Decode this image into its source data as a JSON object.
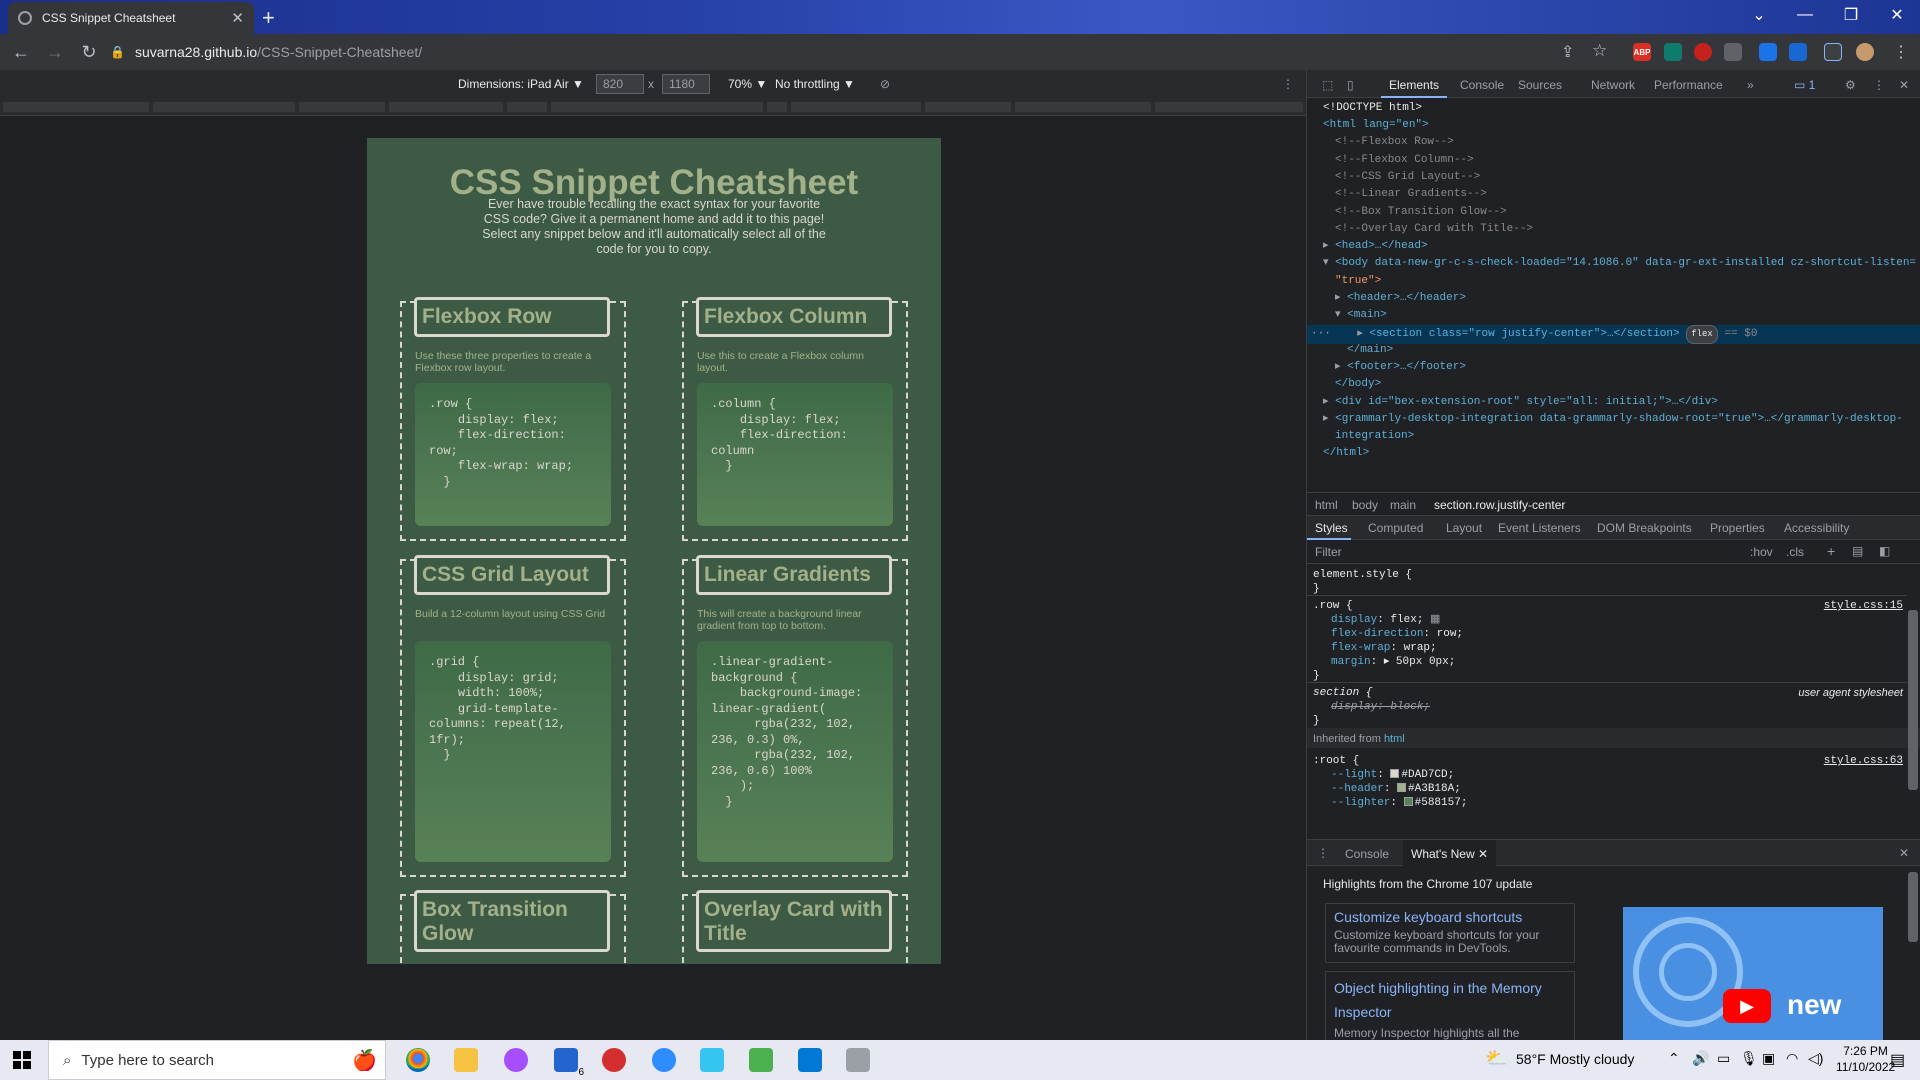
{
  "browser": {
    "tab_title": "CSS Snippet Cheatsheet",
    "url_host": "suvarna28.github.io",
    "url_path": "/CSS-Snippet-Cheatsheet/",
    "ext_abp": "ABP"
  },
  "device_toolbar": {
    "dimensions_label": "Dimensions: iPad Air ▼",
    "width": "820",
    "x": "x",
    "height": "1180",
    "zoom": "70% ▼",
    "throttling": "No throttling ▼"
  },
  "site": {
    "title": "CSS Snippet Cheatsheet",
    "intro": "Ever have trouble recalling the exact syntax for your favorite CSS code? Give it a permanent home and add it to this page! Select any snippet below and it'll automatically select all of the code for you to copy.",
    "cards": [
      {
        "title": "Flexbox Row",
        "desc": "Use these three properties to create a Flexbox row layout.",
        "code": ".row {\n    display: flex;\n    flex-direction: row;\n    flex-wrap: wrap;\n  }"
      },
      {
        "title": "Flexbox Column",
        "desc": "Use this to create a Flexbox column layout.",
        "code": ".column {\n    display: flex;\n    flex-direction:\ncolumn\n  }"
      },
      {
        "title": "CSS Grid Layout",
        "desc": "Build a 12-column layout using CSS Grid",
        "code": ".grid {\n    display: grid;\n    width: 100%;\n    grid-template-\ncolumns: repeat(12,\n1fr);\n  }"
      },
      {
        "title": "Linear Gradients",
        "desc": "This will create a background linear gradient from top to bottom.",
        "code": ".linear-gradient-\nbackground {\n    background-image:\nlinear-gradient(\n      rgba(232, 102,\n236, 0.3) 0%,\n      rgba(232, 102,\n236, 0.6) 100%\n    );\n  }"
      },
      {
        "title": "Box Transition Glow",
        "desc": "",
        "code": ""
      },
      {
        "title": "Overlay Card with Title",
        "desc": "",
        "code": ""
      }
    ]
  },
  "devtools": {
    "tabs": [
      "Elements",
      "Console",
      "Sources",
      "Network",
      "Performance"
    ],
    "more": "»",
    "issues": "1",
    "dom": {
      "doctype": "<!DOCTYPE html>",
      "html_open": "<html lang=\"en\">",
      "comments": [
        "<!--Flexbox Row-->",
        "<!--Flexbox Column-->",
        "<!--CSS Grid Layout-->",
        "<!--Linear Gradients-->",
        "<!--Box Transition Glow-->",
        "<!--Overlay Card with Title-->"
      ],
      "head": "<head>…</head>",
      "body_open": "<body data-new-gr-c-s-check-loaded=\"14.1086.0\" data-gr-ext-installed cz-shortcut-listen=",
      "body_open_cont": "\"true\">",
      "header": "<header>…</header>",
      "main_open": "<main>",
      "section": "<section class=\"row justify-center\">…</section>",
      "flex_badge": "flex",
      "eq0": "== $0",
      "main_close": "</main>",
      "footer": "<footer>…</footer>",
      "body_close": "</body>",
      "bex": "<div id=\"bex-extension-root\" style=\"all: initial;\">…</div>",
      "grammarly": "<grammarly-desktop-integration data-grammarly-shadow-root=\"true\">…</grammarly-desktop-",
      "grammarly_cont": "integration>",
      "html_close": "</html>"
    },
    "breadcrumbs": [
      "html",
      "body",
      "main",
      "section.row.justify-center"
    ],
    "subtabs": [
      "Styles",
      "Computed",
      "Layout",
      "Event Listeners",
      "DOM Breakpoints",
      "Properties",
      "Accessibility"
    ],
    "filter_placeholder": "Filter",
    "hov": ":hov",
    "cls": ".cls",
    "styles": {
      "element_style": "element.style {",
      "close": "}",
      "row_selector": ".row {",
      "row_src": "style.css:15",
      "row_props": [
        {
          "name": "display",
          "value": "flex;"
        },
        {
          "name": "flex-direction",
          "value": "row;"
        },
        {
          "name": "flex-wrap",
          "value": "wrap;"
        },
        {
          "name": "margin",
          "value": "▸ 50px 0px;"
        }
      ],
      "section_selector": "section {",
      "section_src": "user agent stylesheet",
      "section_prop": "display: block;",
      "inherited": "Inherited from",
      "inherited_el": "html",
      "root_selector": ":root {",
      "root_src": "style.css:63",
      "root_vars": [
        {
          "name": "--light",
          "value": "#DAD7CD;",
          "color": "#DAD7CD"
        },
        {
          "name": "--header",
          "value": "#A3B18A;",
          "color": "#A3B18A"
        },
        {
          "name": "--lighter",
          "value": "#588157;",
          "color": "#588157"
        }
      ]
    },
    "drawer": {
      "tabs": [
        "Console",
        "What's New"
      ],
      "heading": "Highlights from the Chrome 107 update",
      "items": [
        {
          "title": "Customize keyboard shortcuts",
          "desc": "Customize keyboard shortcuts for your favourite commands in DevTools."
        },
        {
          "title": "Object highlighting in the Memory Inspector",
          "desc": "Memory Inspector highlights all the"
        }
      ],
      "promo_text": "new"
    }
  },
  "taskbar": {
    "search_placeholder": "Type here to search",
    "weather": "58°F  Mostly cloudy",
    "time": "7:26 PM",
    "date": "11/10/2022",
    "notif": "6"
  }
}
